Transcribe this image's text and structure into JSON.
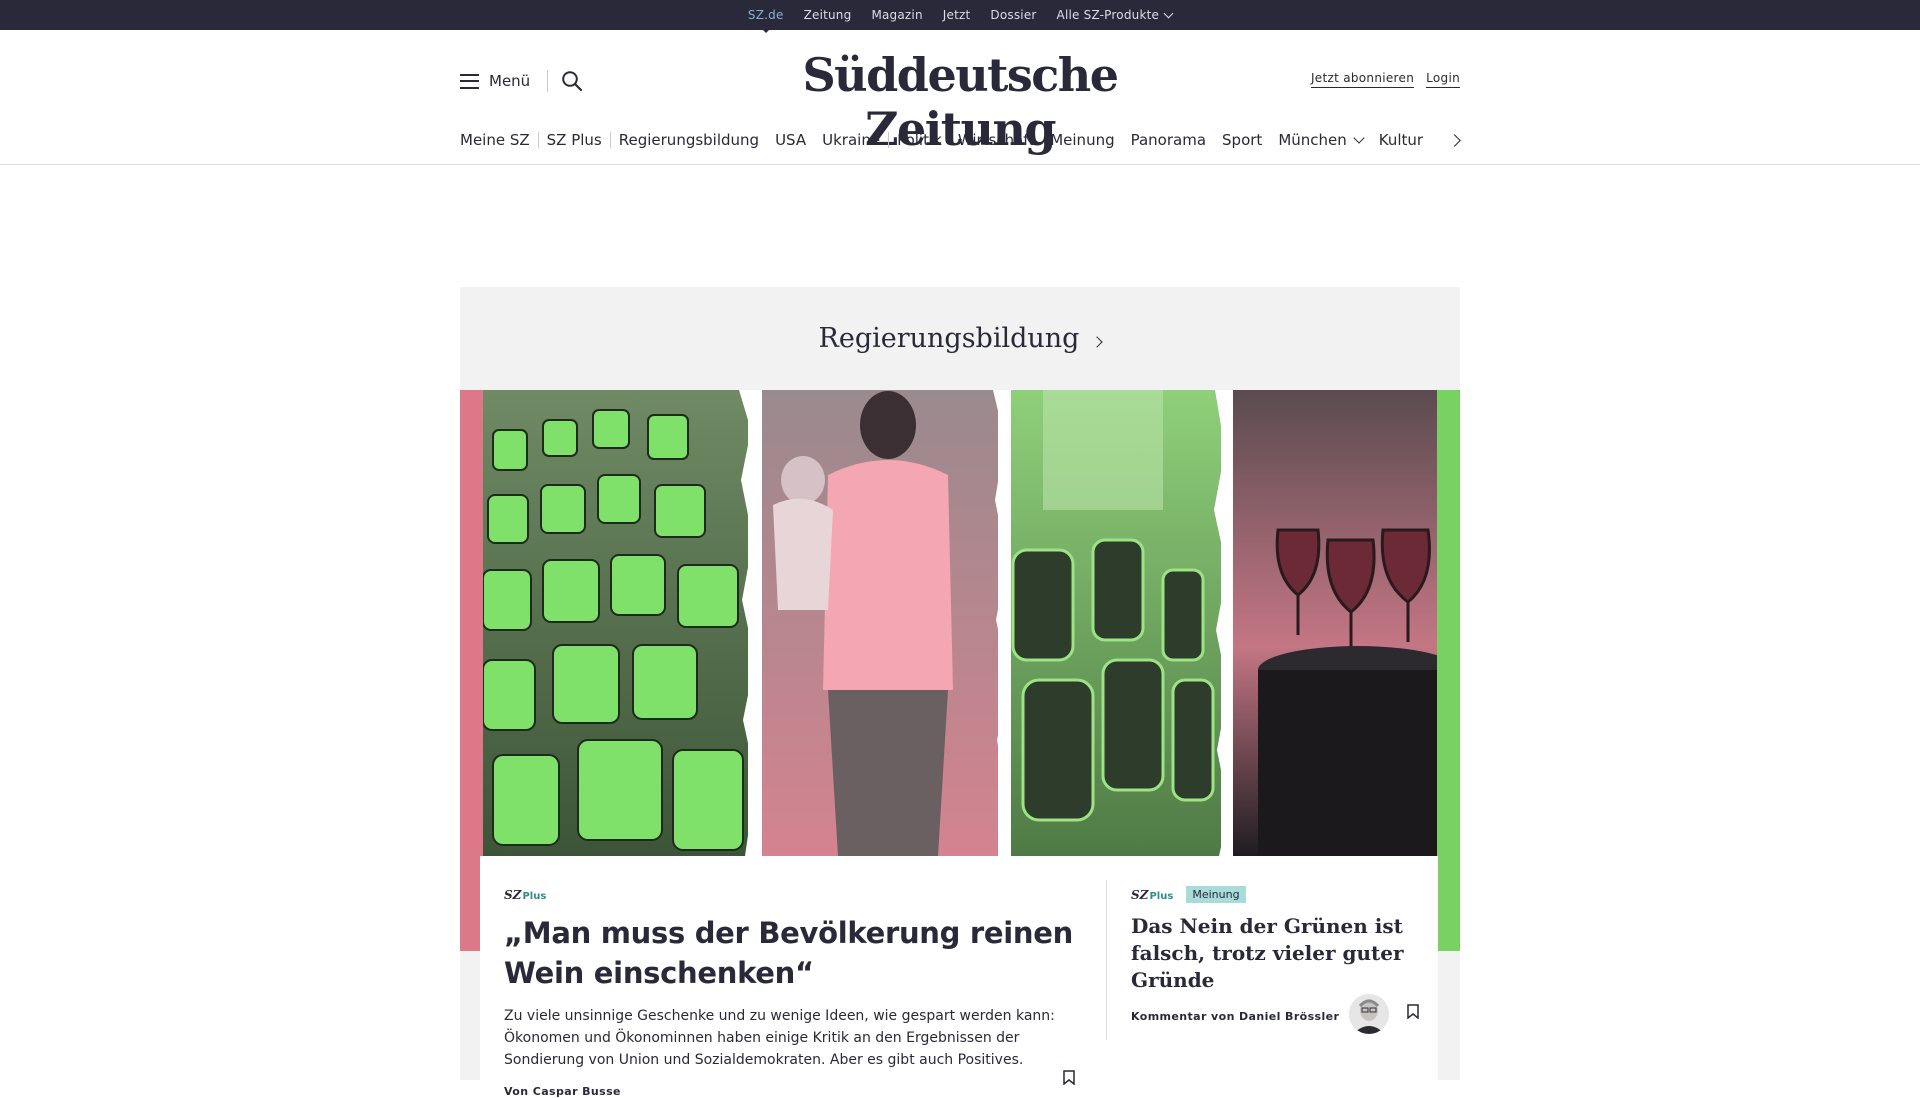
{
  "topbar": {
    "items": [
      "SZ.de",
      "Zeitung",
      "Magazin",
      "Jetzt",
      "Dossier",
      "Alle SZ-Produkte"
    ]
  },
  "header": {
    "menu_label": "Menü",
    "logo_text": "Süddeutsche Zeitung",
    "subscribe_label": "Jetzt abonnieren",
    "login_label": "Login"
  },
  "nav": {
    "items": [
      "Meine SZ",
      "SZ Plus",
      "Regierungsbildung",
      "USA",
      "Ukraine",
      "Politik",
      "Wirtschaft",
      "Meinung",
      "Panorama",
      "Sport",
      "München",
      "Kultur"
    ]
  },
  "dossier": {
    "title": "Regierungsbildung"
  },
  "main_teaser": {
    "brand": "SZ",
    "brand_plus": "Plus",
    "headline": "„Man muss der Bevölkerung reinen Wein einschenken“",
    "text": "Zu viele unsinnige Geschenke und zu wenige Ideen, wie gespart werden kann: Ökonomen und Ökonominnen haben einige Kritik an den Ergebnissen der Sondierung von Union und Sozialdemokraten. Aber es gibt auch Positives.",
    "byline": "Von Caspar Busse"
  },
  "side_teaser": {
    "brand": "SZ",
    "brand_plus": "Plus",
    "tag": "Meinung",
    "headline": "Das Nein der Grünen ist falsch, trotz vieler guter Gründe",
    "byline": "Kommentar von Daniel Brössler"
  },
  "colors": {
    "dark": "#29293a",
    "pink": "#dd7888",
    "green": "#78d160",
    "teal_tag": "#a7dcd8",
    "light_bg": "#f2f2f2"
  }
}
